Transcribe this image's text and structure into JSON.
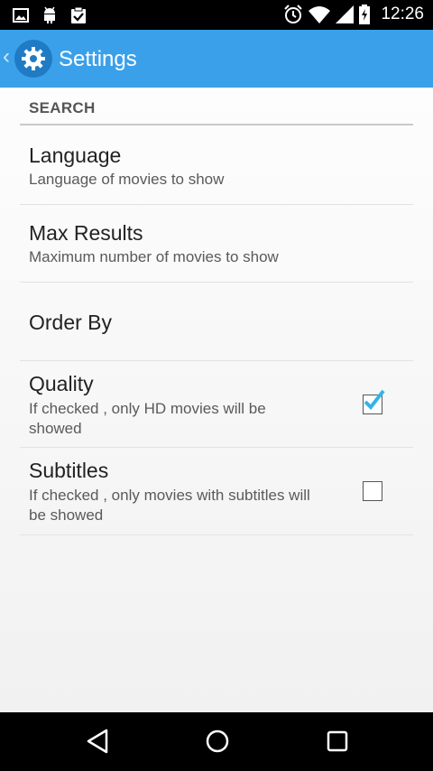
{
  "status_bar": {
    "time": "12:26",
    "left_icons": [
      "image-icon",
      "android-icon",
      "clipboard-check-icon"
    ],
    "right_icons": [
      "alarm-icon",
      "wifi-icon",
      "signal-icon",
      "battery-icon"
    ]
  },
  "action_bar": {
    "title": "Settings",
    "icon": "gear-icon",
    "up_icon": "chevron-left-icon",
    "color": "#3aa0ea"
  },
  "section": {
    "title": "SEARCH"
  },
  "preferences": [
    {
      "title": "Language",
      "summary": "Language of movies to show"
    },
    {
      "title": "Max Results",
      "summary": "Maximum number of movies to show"
    },
    {
      "title": "Order By",
      "summary": ""
    },
    {
      "title": "Quality",
      "summary": "If checked , only HD movies will be showed",
      "checked": true
    },
    {
      "title": "Subtitles",
      "summary": "If checked , only movies with subtitles will be showed",
      "checked": false
    }
  ],
  "nav_bar": {
    "buttons": [
      "back-icon",
      "home-icon",
      "recents-icon"
    ]
  },
  "colors": {
    "accent": "#3aa0ea",
    "check": "#33b5e5"
  }
}
